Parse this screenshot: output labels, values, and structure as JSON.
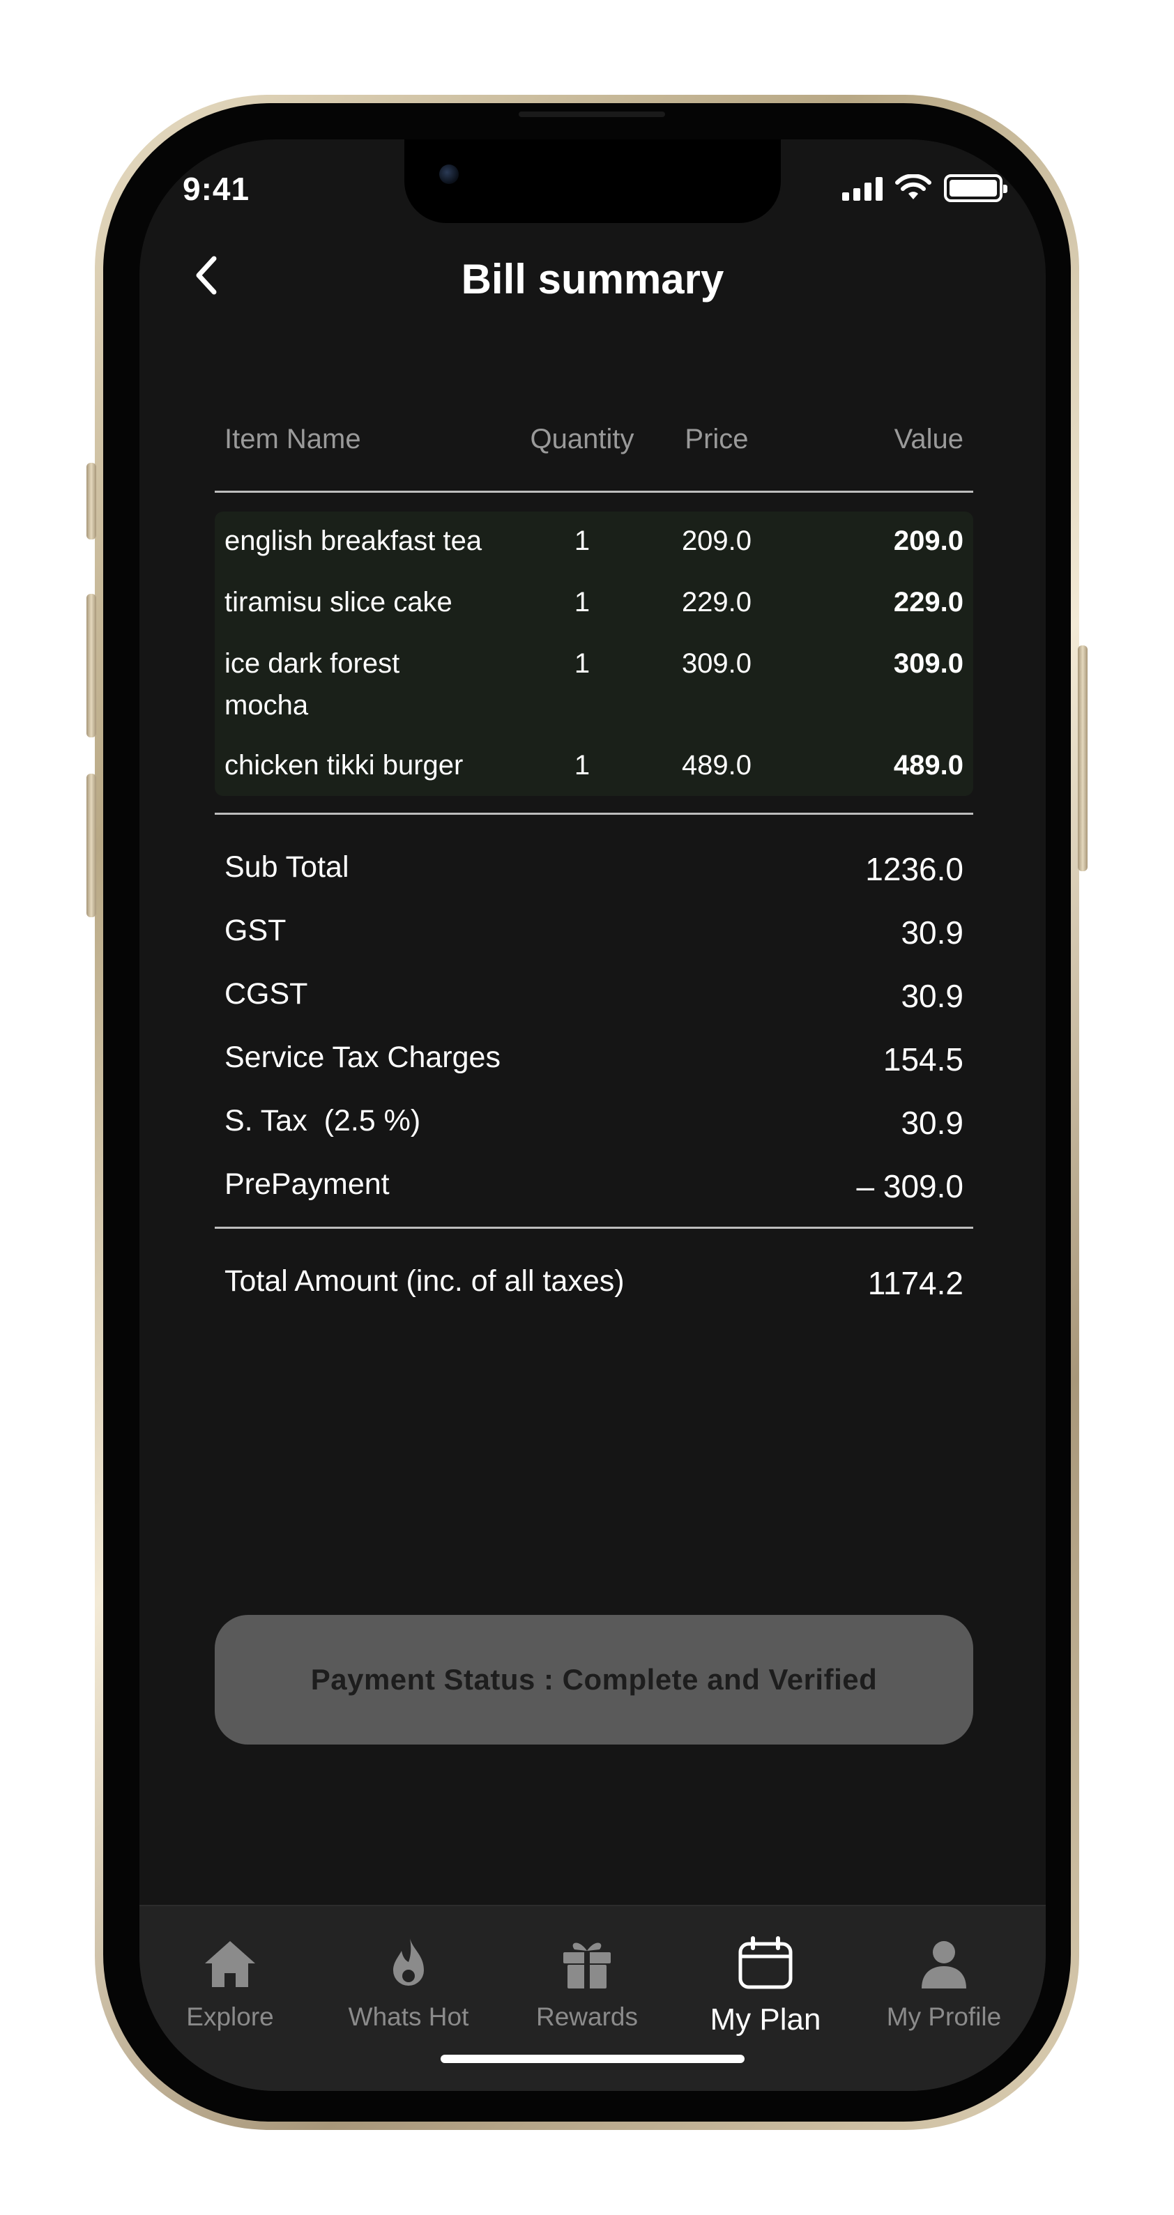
{
  "status_bar": {
    "time": "9:41"
  },
  "header": {
    "title": "Bill summary"
  },
  "table": {
    "columns": [
      "Item Name",
      "Quantity",
      "Price",
      "Value"
    ],
    "items": [
      {
        "name": "english breakfast tea",
        "qty": "1",
        "price": "209.0",
        "value": "209.0"
      },
      {
        "name": "tiramisu slice cake",
        "qty": "1",
        "price": "229.0",
        "value": "229.0"
      },
      {
        "name": "ice dark forest mocha",
        "qty": "1",
        "price": "309.0",
        "value": "309.0"
      },
      {
        "name": "chicken tikki burger",
        "qty": "1",
        "price": "489.0",
        "value": "489.0"
      }
    ]
  },
  "summary": [
    {
      "label": "Sub Total",
      "value": "1236.0"
    },
    {
      "label": "GST",
      "value": "30.9"
    },
    {
      "label": "CGST",
      "value": "30.9"
    },
    {
      "label": "Service Tax Charges",
      "value": "154.5"
    },
    {
      "label": "S. Tax  (2.5 %)",
      "value": "30.9"
    },
    {
      "label": "PrePayment",
      "value": "– 309.0"
    }
  ],
  "total": {
    "label": "Total Amount (inc. of all taxes)",
    "value": "1174.2"
  },
  "payment_status": "Payment Status : Complete and Verified",
  "tabs": [
    {
      "label": "Explore",
      "icon": "home-icon"
    },
    {
      "label": "Whats Hot",
      "icon": "flame-icon"
    },
    {
      "label": "Rewards",
      "icon": "gift-icon"
    },
    {
      "label": "My Plan",
      "icon": "calendar-icon",
      "active": true
    },
    {
      "label": "My Profile",
      "icon": "user-icon"
    }
  ],
  "colors": {
    "background": "#151515",
    "items_highlight": "#1a2019",
    "button": "#5a5a5a",
    "tabbar": "#232323"
  }
}
